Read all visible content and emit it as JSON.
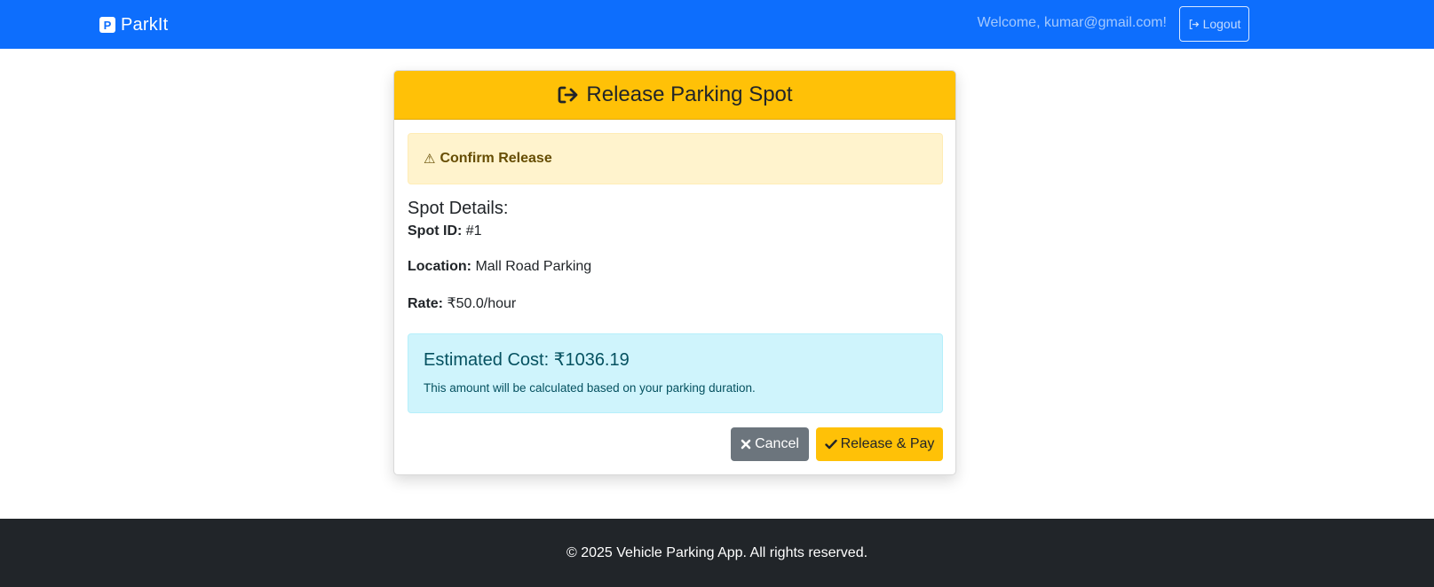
{
  "navbar": {
    "brand": "ParkIt",
    "brand_icon_letter": "P",
    "welcome": "Welcome, kumar@gmail.com!",
    "logout_label": "Logout",
    "bg_color": "#0d6efd"
  },
  "card": {
    "title": "Release Parking Spot",
    "header_color": "#ffc107",
    "alert_title": "Confirm Release",
    "details_title": "Spot Details:",
    "spot_id_label": "Spot ID:",
    "spot_id_value": "#1",
    "location_label": "Location:",
    "location_value": "Mall Road Parking",
    "rate_label": "Rate:",
    "rate_value": "₹50.0/hour",
    "estimated_cost": "Estimated Cost: ₹1036.19",
    "cost_note": "This amount will be calculated based on your parking duration.",
    "cancel_label": "Cancel",
    "release_label": "Release & Pay"
  },
  "icons": {
    "brand": "parking-icon",
    "logout": "sign-out-icon",
    "header": "sign-out-icon",
    "warning": "warning-triangle-icon",
    "cancel": "close-icon",
    "release": "check-icon"
  },
  "footer": {
    "text": "© 2025 Vehicle Parking App. All rights reserved."
  }
}
